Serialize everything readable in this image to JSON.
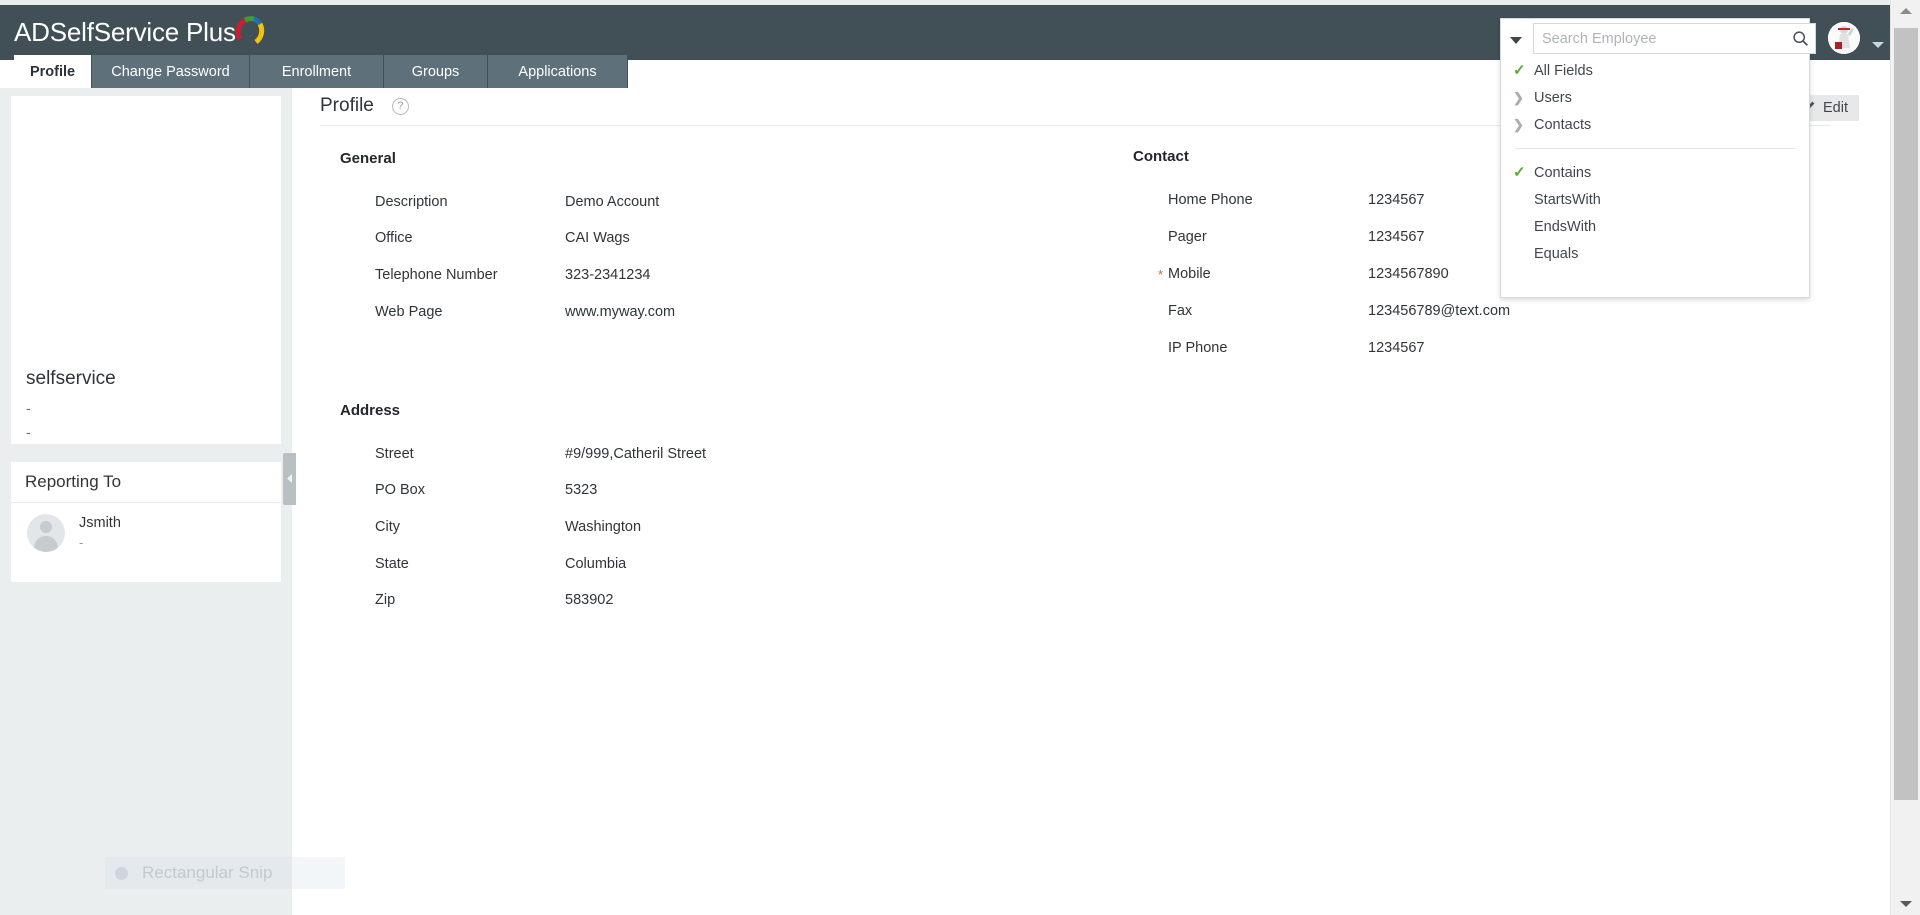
{
  "app": {
    "brand": "ADSelfService Plus",
    "logo_icon": "adselfservice-arc-logo",
    "header_bg": "#414f57",
    "tab_bg": "#5e7079",
    "accent_green": "#5aab2f",
    "required_red": "#e0593b"
  },
  "tabs": [
    {
      "label": "Profile",
      "active": true
    },
    {
      "label": "Change Password",
      "active": false
    },
    {
      "label": "Enrollment",
      "active": false
    },
    {
      "label": "Groups",
      "active": false
    },
    {
      "label": "Applications",
      "active": false
    }
  ],
  "search": {
    "placeholder": "Search Employee",
    "value": "",
    "search_icon": "magnifier-icon",
    "caret_icon": "caret-down-icon",
    "dropdown": {
      "scopes": [
        {
          "label": "All Fields",
          "marker": "check",
          "selected": true
        },
        {
          "label": "Users",
          "marker": "chevron",
          "selected": false
        },
        {
          "label": "Contacts",
          "marker": "chevron",
          "selected": false
        }
      ],
      "operators": [
        {
          "label": "Contains",
          "marker": "check",
          "selected": true
        },
        {
          "label": "StartsWith",
          "marker": "none",
          "selected": false
        },
        {
          "label": "EndsWith",
          "marker": "none",
          "selected": false
        },
        {
          "label": "Equals",
          "marker": "none",
          "selected": false
        }
      ]
    }
  },
  "user_menu": {
    "avatar_icon": "user-avatar",
    "caret_icon": "caret-down-icon"
  },
  "sidebar": {
    "profile_card": {
      "name": "selfservice",
      "line2": "-",
      "line3": "-"
    },
    "reporting_to": {
      "title": "Reporting To",
      "items": [
        {
          "name": "Jsmith",
          "subtitle": "-",
          "avatar_icon": "user-avatar-placeholder"
        }
      ]
    },
    "collapse_icon": "chevron-left-icon"
  },
  "main": {
    "page_title": "Profile",
    "help_icon": "question-mark-icon",
    "edit_button": {
      "label": "Edit",
      "icon": "pencil-icon"
    },
    "sections": {
      "general": {
        "heading": "General",
        "fields": [
          {
            "label": "Description",
            "value": "Demo Account",
            "required": false
          },
          {
            "label": "Office",
            "value": "CAI Wags",
            "required": false
          },
          {
            "label": "Telephone Number",
            "value": "323-2341234",
            "required": false
          },
          {
            "label": "Web Page",
            "value": "www.myway.com",
            "required": false
          }
        ]
      },
      "address": {
        "heading": "Address",
        "fields": [
          {
            "label": "Street",
            "value": "#9/999,Catheril Street",
            "required": false
          },
          {
            "label": "PO Box",
            "value": "5323",
            "required": false
          },
          {
            "label": "City",
            "value": "Washington",
            "required": false
          },
          {
            "label": "State",
            "value": "Columbia",
            "required": false
          },
          {
            "label": "Zip",
            "value": "583902",
            "required": false
          }
        ]
      },
      "contact": {
        "heading": "Contact",
        "fields": [
          {
            "label": "Home Phone",
            "value": "1234567",
            "required": false
          },
          {
            "label": "Pager",
            "value": "1234567",
            "required": false
          },
          {
            "label": "Mobile",
            "value": "1234567890",
            "required": true
          },
          {
            "label": "Fax",
            "value": "123456789@text.com",
            "required": false
          },
          {
            "label": "IP Phone",
            "value": "1234567",
            "required": false
          }
        ]
      }
    }
  },
  "overlay": {
    "snip_label": "Rectangular Snip",
    "snip_icon": "record-dot-icon"
  },
  "scrollbar": {
    "up_icon": "triangle-up-icon",
    "down_icon": "triangle-down-icon"
  }
}
